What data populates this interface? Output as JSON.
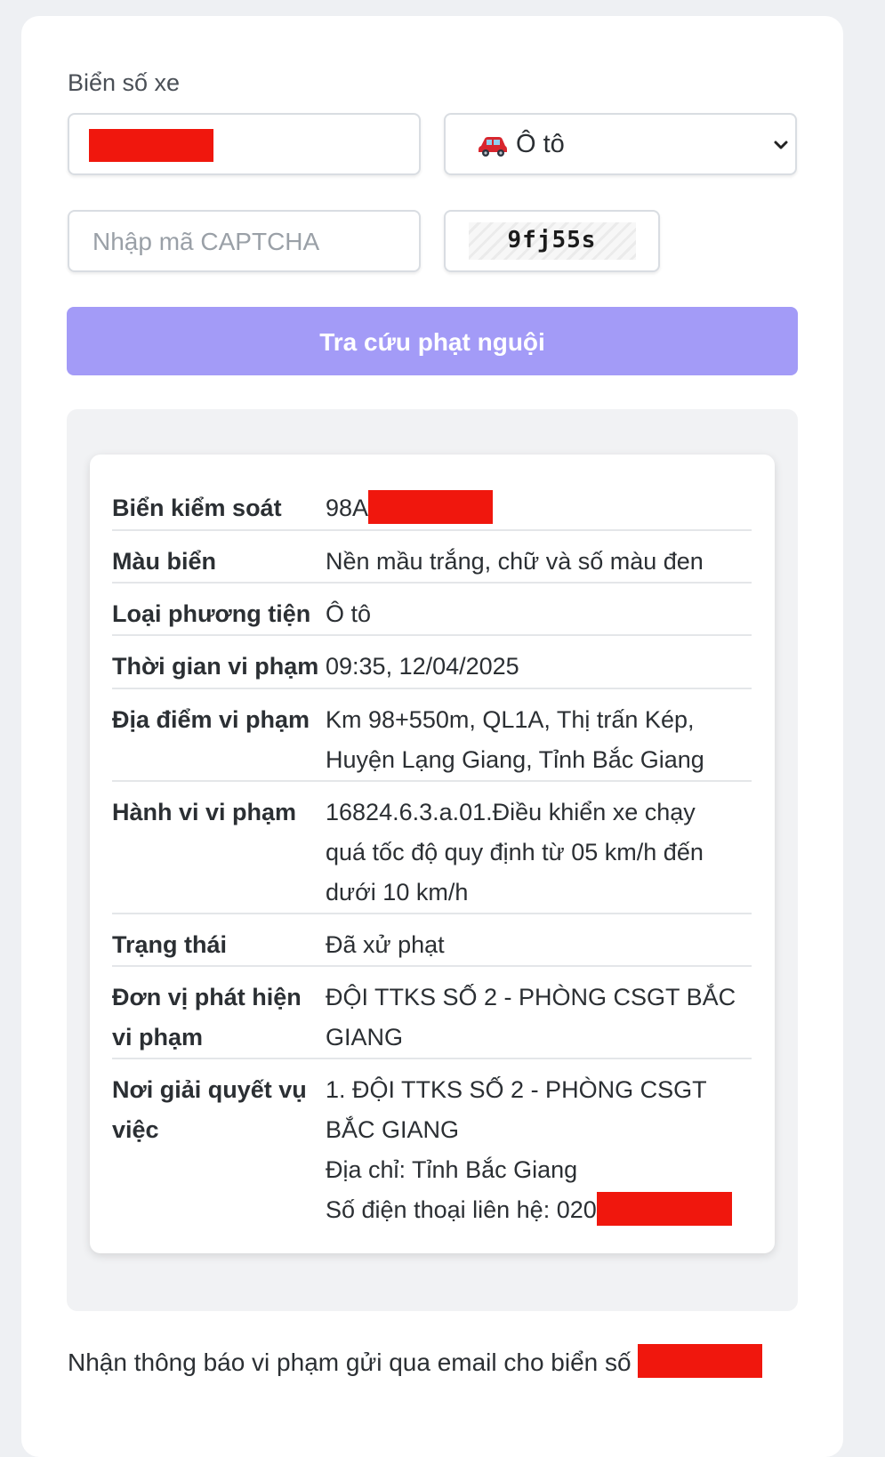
{
  "form": {
    "plate_label": "Biển số xe",
    "vehicle_type": {
      "icon": "car-icon",
      "selected": "Ô tô"
    },
    "captcha_placeholder": "Nhập mã CAPTCHA",
    "captcha_code": "9fj55s",
    "search_button": "Tra cứu phạt nguội"
  },
  "colors": {
    "button": "#a39bf7",
    "redaction": "#f0170d"
  },
  "result": {
    "rows": [
      {
        "key": "Biển kiểm soát",
        "value": "98A"
      },
      {
        "key": "Màu biển",
        "value": "Nền mầu trắng, chữ và số màu đen"
      },
      {
        "key": "Loại phương tiện",
        "value": "Ô tô"
      },
      {
        "key": "Thời gian vi phạm",
        "value": "09:35, 12/04/2025"
      },
      {
        "key": "Địa điểm vi phạm",
        "value": [
          "Km 98+550m, QL1A, Thị trấn Kép,",
          "Huyện Lạng Giang, Tỉnh Bắc Giang"
        ]
      },
      {
        "key": "Hành vi vi phạm",
        "value": [
          "16824.6.3.a.01.Điều khiển xe chạy",
          "quá tốc độ quy định từ 05 km/h đến",
          "dưới 10 km/h"
        ]
      },
      {
        "key": "Trạng thái",
        "value": "Đã xử phạt"
      },
      {
        "key": [
          "Đơn vị phát hiện",
          "vi phạm"
        ],
        "value": [
          "ĐỘI TTKS SỐ 2 - PHÒNG CSGT BẮC",
          "GIANG"
        ]
      },
      {
        "key": [
          "Nơi giải quyết vụ",
          "việc"
        ],
        "value": [
          "1. ĐỘI TTKS SỐ 2 - PHÒNG CSGT",
          "BẮC GIANG",
          "Địa chỉ: Tỉnh Bắc Giang",
          "Số điện thoại liên hệ: 020"
        ]
      }
    ]
  },
  "footer": {
    "email_notice": "Nhận thông báo vi phạm gửi qua email cho biển số"
  }
}
